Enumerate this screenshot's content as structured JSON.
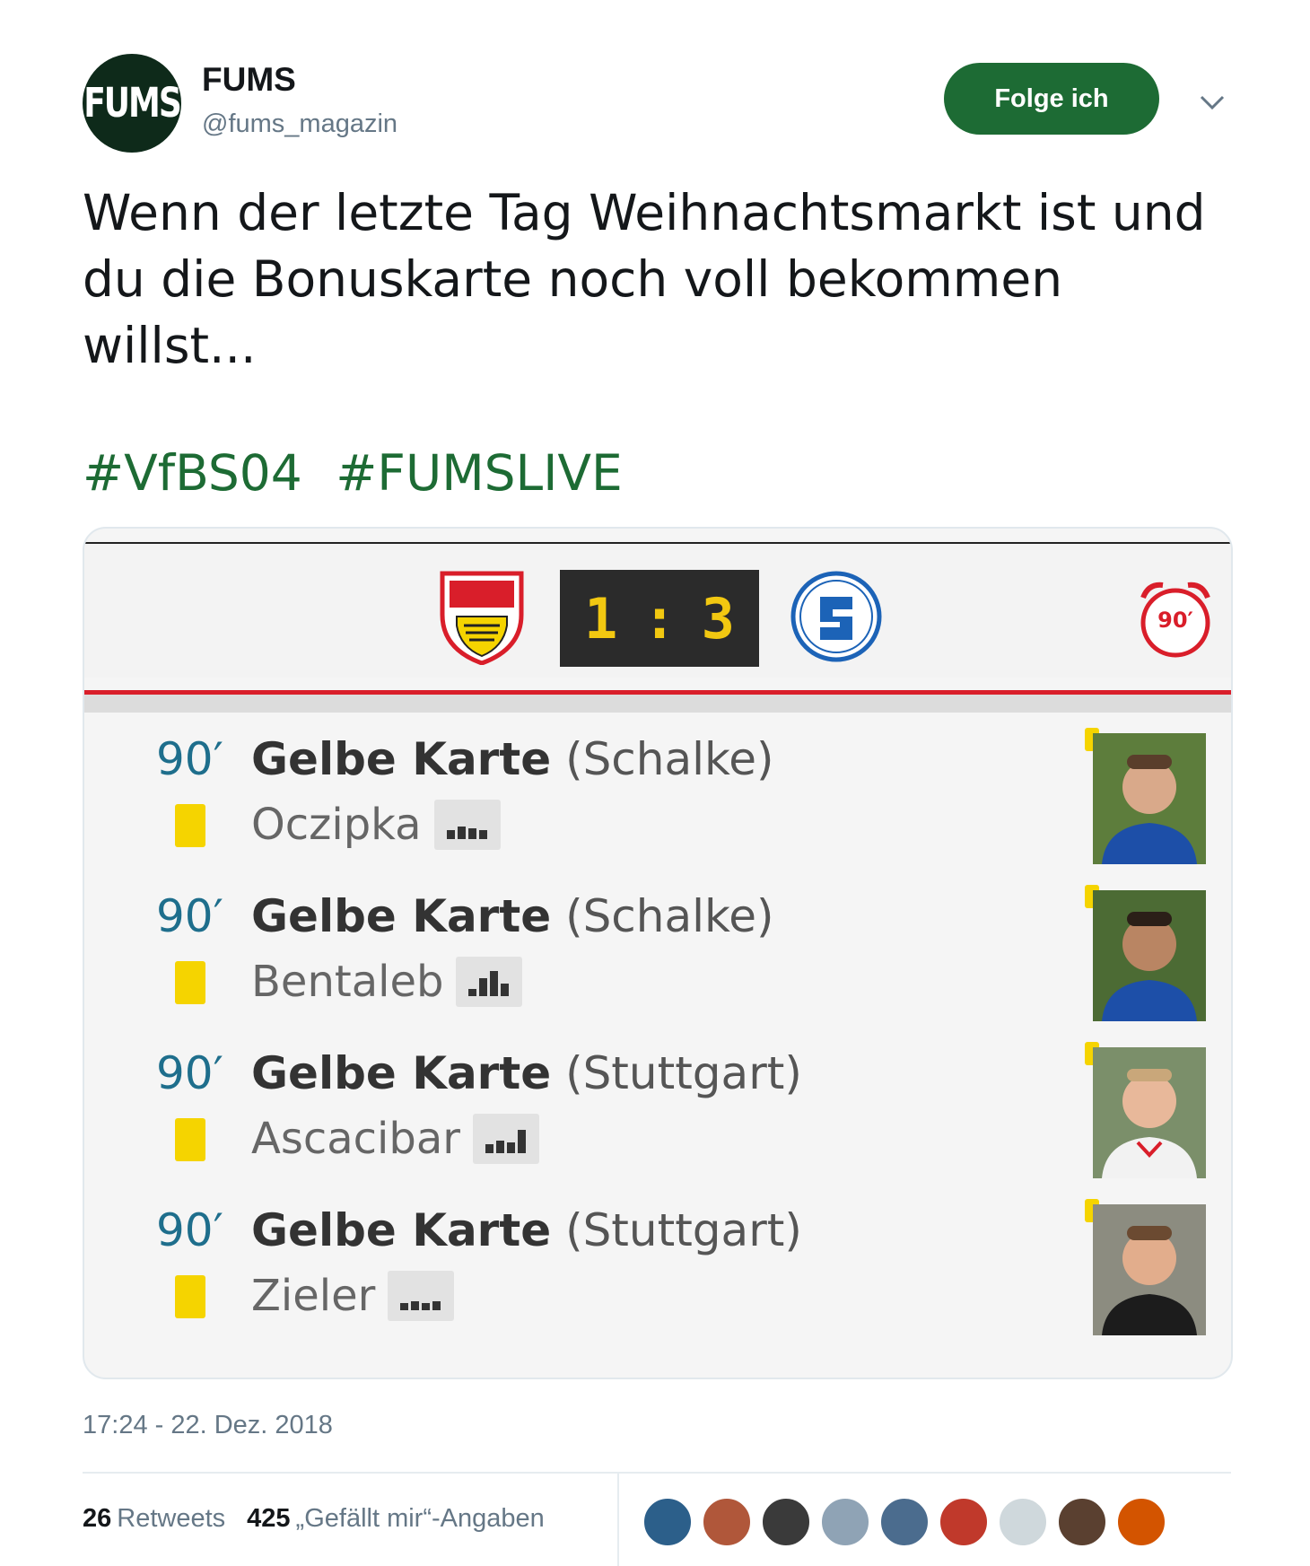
{
  "header": {
    "avatar_text": "FUMS",
    "name": "FUMS",
    "handle": "@fums_magazin",
    "follow_label": "Folge ich"
  },
  "tweet": {
    "text": "Wenn der letzte Tag Weihnachtsmarkt ist und du die Bonuskarte noch voll bekommen willst...",
    "hashtags": [
      "#VfBS04",
      "#FUMSLIVE"
    ]
  },
  "match": {
    "home_score": "1",
    "separator": ":",
    "away_score": "3",
    "clock_label": "90′",
    "events": [
      {
        "minute": "90′",
        "type": "Gelbe Karte",
        "team": "(Schalke)",
        "player": "Oczipka",
        "jersey": "#1d4fa8"
      },
      {
        "minute": "90′",
        "type": "Gelbe Karte",
        "team": "(Schalke)",
        "player": "Bentaleb",
        "jersey": "#1d4fa8"
      },
      {
        "minute": "90′",
        "type": "Gelbe Karte",
        "team": "(Stuttgart)",
        "player": "Ascacibar",
        "jersey": "#f2f2f2"
      },
      {
        "minute": "90′",
        "type": "Gelbe Karte",
        "team": "(Stuttgart)",
        "player": "Zieler",
        "jersey": "#1c1c1c"
      }
    ]
  },
  "footer": {
    "timestamp": "17:24 - 22. Dez. 2018",
    "retweets_count": "26",
    "retweets_label": "Retweets",
    "likes_count": "425",
    "likes_label": "„Gefällt mir“-Angaben",
    "liker_colors": [
      "#2c5f8a",
      "#b0573a",
      "#3a3a3a",
      "#8fa3b5",
      "#4b6c8e",
      "#c0392b",
      "#cfd8dc",
      "#5a4030",
      "#d35400"
    ]
  },
  "colors": {
    "brand_green": "#1d6b34",
    "link_green": "#1d6b34",
    "minute_blue": "#1e6e8c",
    "card_yellow": "#f5d400",
    "accent_red": "#d91e2a"
  }
}
